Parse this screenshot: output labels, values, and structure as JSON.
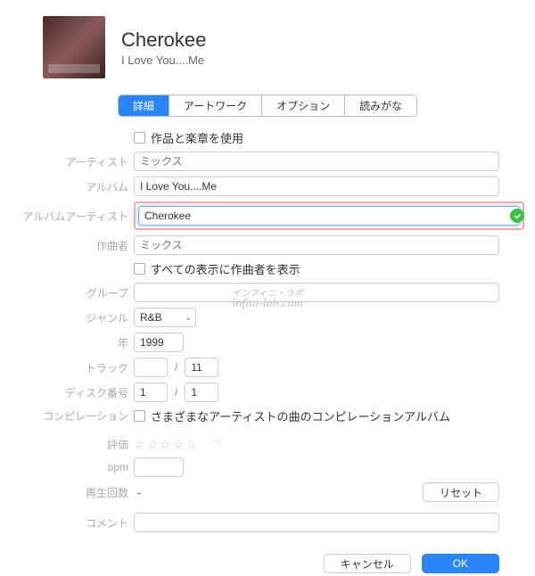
{
  "header": {
    "title": "Cherokee",
    "subtitle": "I Love You....Me"
  },
  "tabs": {
    "items": [
      "詳細",
      "アートワーク",
      "オプション",
      "読みがな"
    ],
    "active_index": 0
  },
  "form": {
    "use_work_chapter": {
      "label": "作品と楽章を使用",
      "checked": false
    },
    "artist": {
      "label": "アーティスト",
      "placeholder": "ミックス",
      "value": ""
    },
    "album": {
      "label": "アルバム",
      "value": "I Love You....Me"
    },
    "album_artist": {
      "label": "アルバムアーティスト",
      "value": "Cherokee",
      "verified": true
    },
    "composer": {
      "label": "作曲者",
      "placeholder": "ミックス",
      "value": ""
    },
    "show_composer": {
      "label": "すべての表示に作曲者を表示",
      "checked": false
    },
    "grouping": {
      "label": "グループ",
      "value": ""
    },
    "genre": {
      "label": "ジャンル",
      "value": "R&B"
    },
    "year": {
      "label": "年",
      "value": "1999"
    },
    "track": {
      "label": "トラック",
      "num": "",
      "total": "11",
      "sep": "/"
    },
    "disc": {
      "label": "ディスク番号",
      "num": "1",
      "total": "1",
      "sep": "/"
    },
    "compilation": {
      "label": "コンピレーション",
      "text": "さまざまなアーティストの曲のコンピレーションアルバム",
      "checked": false
    },
    "rating": {
      "label": "評価",
      "stars": "☆☆☆☆☆",
      "heart": "♡"
    },
    "bpm": {
      "label": "bpm",
      "value": ""
    },
    "plays": {
      "label": "再生回数",
      "value": "-",
      "reset": "リセット"
    },
    "comment": {
      "label": "コメント",
      "value": ""
    }
  },
  "footer": {
    "cancel": "キャンセル",
    "ok": "OK"
  },
  "watermark": {
    "small": "インフィニ・ラボ",
    "main": "infini-lab.com"
  }
}
